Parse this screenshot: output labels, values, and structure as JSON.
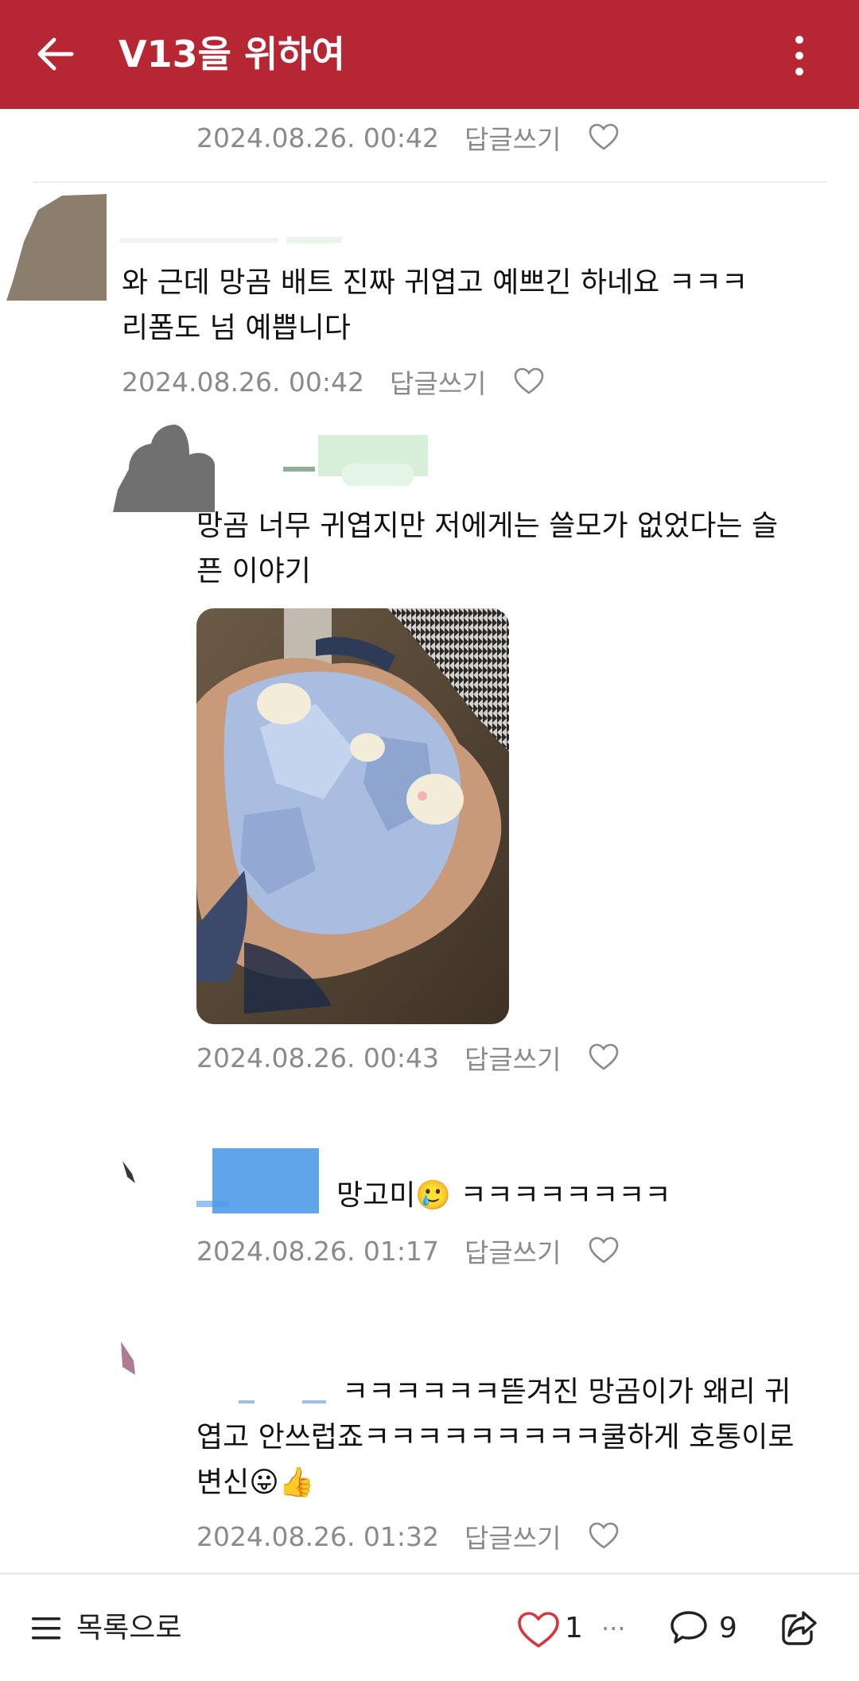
{
  "header": {
    "title": "V13을 위하여",
    "back_icon": "arrow-left-icon",
    "menu_icon": "more-vertical-icon",
    "background": "#b72633"
  },
  "comments": [
    {
      "date": "2024.08.26. 00:42",
      "reply_label": "답글쓰기"
    },
    {
      "text_lines": [
        "와 근데 망곰 배트 진짜 귀엽고 예쁘긴 하네요 ㅋㅋㅋ",
        "리폼도 넘 예쁩니다"
      ],
      "date": "2024.08.26. 00:42",
      "reply_label": "답글쓰기"
    },
    {
      "text_lines": [
        "망곰 너무 귀엽지만 저에게는 쓸모가 없었다는 슬",
        "픈 이야기"
      ],
      "has_photo": true,
      "date": "2024.08.26. 00:43",
      "reply_label": "답글쓰기"
    },
    {
      "text_lines": [
        "망고미🥲 ㅋㅋㅋㅋㅋㅋㅋㅋ"
      ],
      "date": "2024.08.26. 01:17",
      "reply_label": "답글쓰기"
    },
    {
      "text_lines": [
        "ㅋㅋㅋㅋㅋㅋ뜯겨진 망곰이가 왜리 귀",
        "엽고 안쓰럽죠ㅋㅋㅋㅋㅋㅋㅋㅋㅋ쿨하게 호통이로",
        "변신😛👍"
      ],
      "date": "2024.08.26. 01:32",
      "reply_label": "답글쓰기"
    }
  ],
  "bottom_bar": {
    "list_label": "목록으로",
    "list_icon": "menu-lines-icon",
    "like_icon": "heart-icon",
    "like_count": "1",
    "more_dots": "···",
    "comment_icon": "speech-bubble-icon",
    "comment_count": "9",
    "share_icon": "share-icon",
    "like_color": "#d9343f"
  }
}
